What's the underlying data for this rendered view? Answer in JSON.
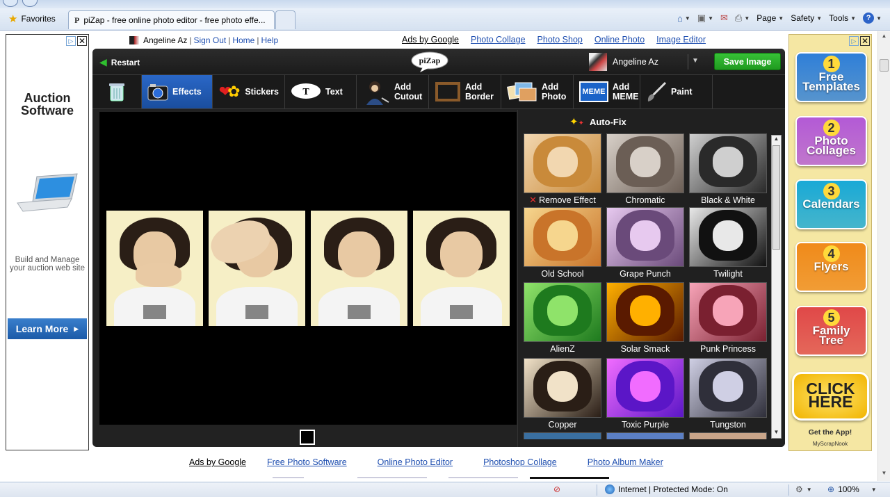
{
  "browser": {
    "favorites_label": "Favorites",
    "tab_title": "piZap - free online photo editor - free photo effe...",
    "commands": {
      "page": "Page",
      "safety": "Safety",
      "tools": "Tools"
    }
  },
  "left_ad": {
    "title": "Auction Software",
    "description": "Build and Manage your auction web site",
    "cta": "Learn More"
  },
  "top_links": {
    "user": "Angeline Az",
    "sign_out": "Sign Out",
    "home": "Home",
    "help": "Help"
  },
  "top_ads": {
    "ads_by": "Ads by Google",
    "links": [
      "Photo Collage",
      "Photo Shop",
      "Online Photo",
      "Image Editor"
    ]
  },
  "editor": {
    "restart": "Restart",
    "logo_text": "piZap",
    "user_name": "Angeline Az",
    "save_button": "Save Image",
    "tools": [
      {
        "name": "trash",
        "label": ""
      },
      {
        "name": "effects",
        "label": "Effects"
      },
      {
        "name": "stickers",
        "label": "Stickers"
      },
      {
        "name": "text",
        "label": "Text"
      },
      {
        "name": "add-cutout",
        "label": "Add\nCutout"
      },
      {
        "name": "add-border",
        "label": "Add\nBorder"
      },
      {
        "name": "add-photo",
        "label": "Add\nPhoto"
      },
      {
        "name": "add-meme",
        "label": "Add\nMEME"
      },
      {
        "name": "paint",
        "label": "Paint"
      }
    ],
    "meme_icon_text": "MEME",
    "text_icon_text": "T",
    "panel": {
      "autofix": "Auto-Fix",
      "effects": [
        {
          "label": "Remove Effect",
          "colors": [
            "#c98a3a",
            "#f2d7b0"
          ]
        },
        {
          "label": "Chromatic",
          "colors": [
            "#6b5e55",
            "#d8d0c8"
          ]
        },
        {
          "label": "Black & White",
          "colors": [
            "#2a2a2a",
            "#cfcfcf"
          ]
        },
        {
          "label": "Old School",
          "colors": [
            "#c9742a",
            "#f6d68e"
          ]
        },
        {
          "label": "Grape Punch",
          "colors": [
            "#6a4a7a",
            "#e7c9ef"
          ]
        },
        {
          "label": "Twilight",
          "colors": [
            "#111111",
            "#e8e8e8"
          ]
        },
        {
          "label": "AlienZ",
          "colors": [
            "#1e7a1e",
            "#8fe36a"
          ]
        },
        {
          "label": "Solar Smack",
          "colors": [
            "#5a1a00",
            "#ffb000"
          ]
        },
        {
          "label": "Punk Princess",
          "colors": [
            "#7a2030",
            "#f7a4b8"
          ]
        },
        {
          "label": "Copper",
          "colors": [
            "#2a1e16",
            "#f1e2c8"
          ]
        },
        {
          "label": "Toxic Purple",
          "colors": [
            "#5b16c7",
            "#f16cff"
          ]
        },
        {
          "label": "Tungston",
          "colors": [
            "#2f2f3a",
            "#cfcfe4"
          ]
        }
      ]
    }
  },
  "right_ad": {
    "items": [
      {
        "num": "1",
        "label": "Free\nTemplates",
        "color": "#2f7fd8"
      },
      {
        "num": "2",
        "label": "Photo\nCollages",
        "color": "#b35ad6"
      },
      {
        "num": "3",
        "label": "Calendars",
        "color": "#19a9d6"
      },
      {
        "num": "4",
        "label": "Flyers",
        "color": "#f08a1a"
      },
      {
        "num": "5",
        "label": "Family\nTree",
        "color": "#e04848"
      }
    ],
    "click_here": "CLICK\nHERE",
    "get_app": "Get the App!",
    "brand": "MyScrapNook"
  },
  "bottom_ads": {
    "ads_by": "Ads by Google",
    "links": [
      "Free Photo Software",
      "Online Photo Editor",
      "Photoshop Collage",
      "Photo Album Maker"
    ]
  },
  "status_bar": {
    "zone": "Internet | Protected Mode: On",
    "zoom": "100%"
  }
}
